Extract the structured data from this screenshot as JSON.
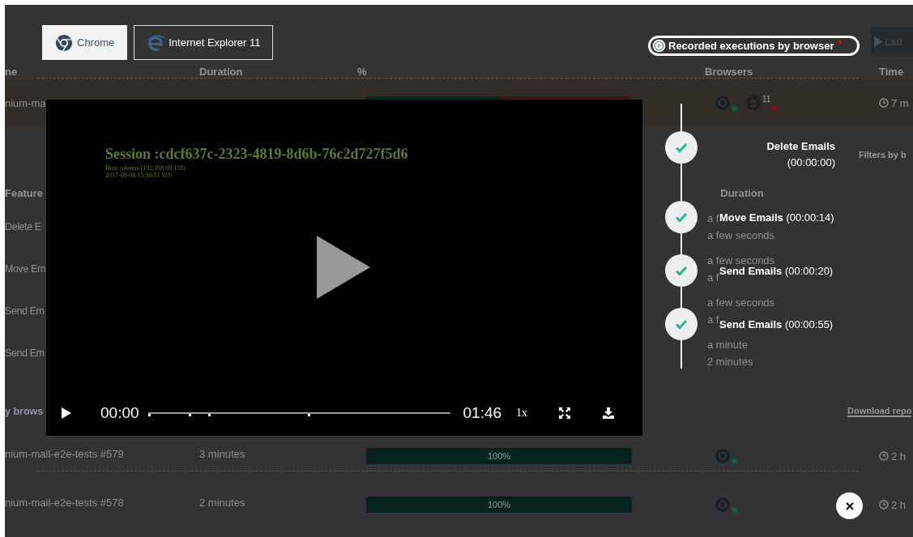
{
  "browser_tabs": [
    {
      "label": "Chrome",
      "selected": true
    },
    {
      "label": "Internet Explorer 11",
      "selected": false
    }
  ],
  "recorded_toggle": {
    "label": "Recorded executions by browser",
    "on": true
  },
  "launch_button": {
    "label": "Lau"
  },
  "runs_table": {
    "columns": [
      "ne",
      "Duration",
      "%",
      "Browsers",
      "Time"
    ],
    "rows": [
      {
        "name": "nium-ma",
        "level": 0.5,
        "browsers": [
          {
            "kind": "chrome",
            "color": "#0b5e4a"
          },
          {
            "kind": "ie",
            "version": "11",
            "color": "#7a1616"
          }
        ],
        "time": "7 m"
      }
    ]
  },
  "features": {
    "filters_label": "Filters by b",
    "columns": [
      "Feature",
      "Duration"
    ],
    "rows": [
      {
        "name": "Delete E",
        "durations": [
          "a f",
          "a few seconds"
        ]
      },
      {
        "name": "Move Em",
        "durations": [
          "a few seconds",
          "a f"
        ]
      },
      {
        "name": "Send Em",
        "durations": [
          "a few seconds",
          "a f"
        ]
      },
      {
        "name": "Send Em",
        "durations": [
          "a minute",
          "2 minutes"
        ]
      }
    ]
  },
  "by_browser": {
    "title": "y brows",
    "download_link": "Download repo",
    "rows": [
      {
        "name": "nium-mail-e2e-tests #579",
        "duration": "3 minutes",
        "level": 1,
        "bar_label": "100%",
        "browsers": [
          {
            "kind": "chrome",
            "color": "#0b5e4a"
          }
        ],
        "time": "2 h"
      },
      {
        "name": "nium-mail-e2e-tests #578",
        "duration": "2 minutes",
        "level": 1,
        "bar_label": "100%",
        "browsers": [
          {
            "kind": "chrome",
            "color": "#0b5e4a"
          }
        ],
        "time": "2 h"
      }
    ]
  },
  "video": {
    "session": "Session :cdcf637c-2323-4819-8d6b-76c2d727f5d6",
    "host": "Host :silenus (192.168.69.118)",
    "timestamp": "2017-08-04 15:30:51.919",
    "current": "00:00",
    "total": "01:46",
    "speed": "1x",
    "level": 0
  },
  "timeline": [
    {
      "kind": "stacked",
      "name": "Delete Emails",
      "time": "(00:00:00)",
      "passed": true
    },
    {
      "kind": "inline",
      "name": "Move Emails",
      "time": "(00:00:14)",
      "passed": true
    },
    {
      "kind": "inline",
      "name": "Send Emails",
      "time": "(00:00:20)",
      "passed": true
    },
    {
      "kind": "inline",
      "name": "Send Emails",
      "time": "(00:00:55)",
      "passed": true
    }
  ]
}
